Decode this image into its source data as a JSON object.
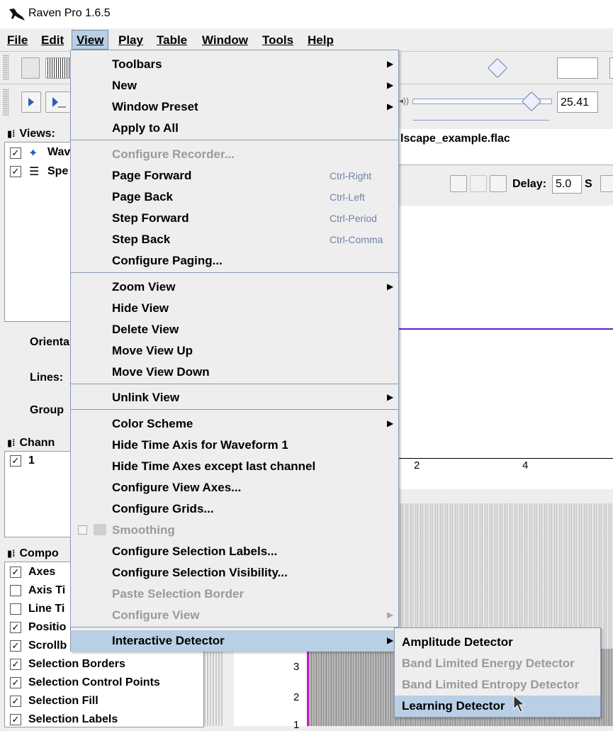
{
  "window": {
    "title": "Raven Pro 1.6.5"
  },
  "menubar": {
    "items": [
      {
        "label": "File"
      },
      {
        "label": "Edit"
      },
      {
        "label": "View"
      },
      {
        "label": "Play"
      },
      {
        "label": "Table"
      },
      {
        "label": "Window"
      },
      {
        "label": "Tools"
      },
      {
        "label": "Help"
      }
    ]
  },
  "toolbar": {
    "rate_value": "25.41",
    "delay_label": "Delay:",
    "delay_value": "5.0",
    "delay_unit": "S"
  },
  "panels": {
    "views_header": "Views:",
    "views_items": [
      "Wav",
      "Spe"
    ],
    "orientation_label": "Orienta",
    "lines_label": "Lines:",
    "group_label": "Group",
    "channels_header": "Chann",
    "channel_item": "1",
    "components_header": "Compo",
    "components": [
      {
        "label": "Axes",
        "checked": true
      },
      {
        "label": "Axis Ti",
        "checked": false
      },
      {
        "label": "Line Ti",
        "checked": false
      },
      {
        "label": "Positio",
        "checked": true
      },
      {
        "label": "Scrollb",
        "checked": true
      },
      {
        "label": "Selection Borders",
        "checked": true
      },
      {
        "label": "Selection Control Points",
        "checked": true
      },
      {
        "label": "Selection Fill",
        "checked": true
      },
      {
        "label": "Selection Labels",
        "checked": true
      }
    ]
  },
  "document": {
    "tab_title": "lscape_example.flac",
    "time_ticks": [
      "2",
      "4"
    ],
    "freq_ticks": [
      "3",
      "2",
      "1"
    ]
  },
  "view_menu": {
    "items": [
      {
        "label": "Toolbars",
        "submenu": true
      },
      {
        "label": "New",
        "submenu": true
      },
      {
        "label": "Window Preset",
        "submenu": true
      },
      {
        "label": "Apply to All"
      },
      {
        "label": "Configure Recorder...",
        "disabled": true
      },
      {
        "label": "Page Forward",
        "accel": "Ctrl-Right"
      },
      {
        "label": "Page Back",
        "accel": "Ctrl-Left"
      },
      {
        "label": "Step Forward",
        "accel": "Ctrl-Period"
      },
      {
        "label": "Step Back",
        "accel": "Ctrl-Comma"
      },
      {
        "label": "Configure Paging..."
      },
      {
        "label": "Zoom View",
        "submenu": true
      },
      {
        "label": "Hide View"
      },
      {
        "label": "Delete View"
      },
      {
        "label": "Move View Up"
      },
      {
        "label": "Move View Down"
      },
      {
        "label": "Unlink View",
        "submenu": true
      },
      {
        "label": "Color Scheme",
        "submenu": true
      },
      {
        "label": "Hide Time Axis for Waveform 1"
      },
      {
        "label": "Hide Time Axes except last channel"
      },
      {
        "label": "Configure View Axes..."
      },
      {
        "label": "Configure Grids..."
      },
      {
        "label": "Smoothing",
        "disabled": true,
        "checkbox": true
      },
      {
        "label": "Configure Selection Labels..."
      },
      {
        "label": "Configure Selection Visibility..."
      },
      {
        "label": "Paste Selection Border",
        "disabled": true
      },
      {
        "label": "Configure View",
        "disabled": true,
        "submenu": true
      },
      {
        "label": "Interactive Detector",
        "submenu": true,
        "selected": true
      }
    ]
  },
  "detector_submenu": {
    "items": [
      {
        "label": "Amplitude Detector"
      },
      {
        "label": "Band Limited Energy Detector",
        "disabled": true
      },
      {
        "label": "Band Limited Entropy Detector",
        "disabled": true
      },
      {
        "label": "Learning Detector",
        "selected": true
      }
    ]
  },
  "colors": {
    "menu_highlight": "#b8cfe5",
    "waveform": "#5b1fd6",
    "accelerator": "#6f84a8"
  }
}
